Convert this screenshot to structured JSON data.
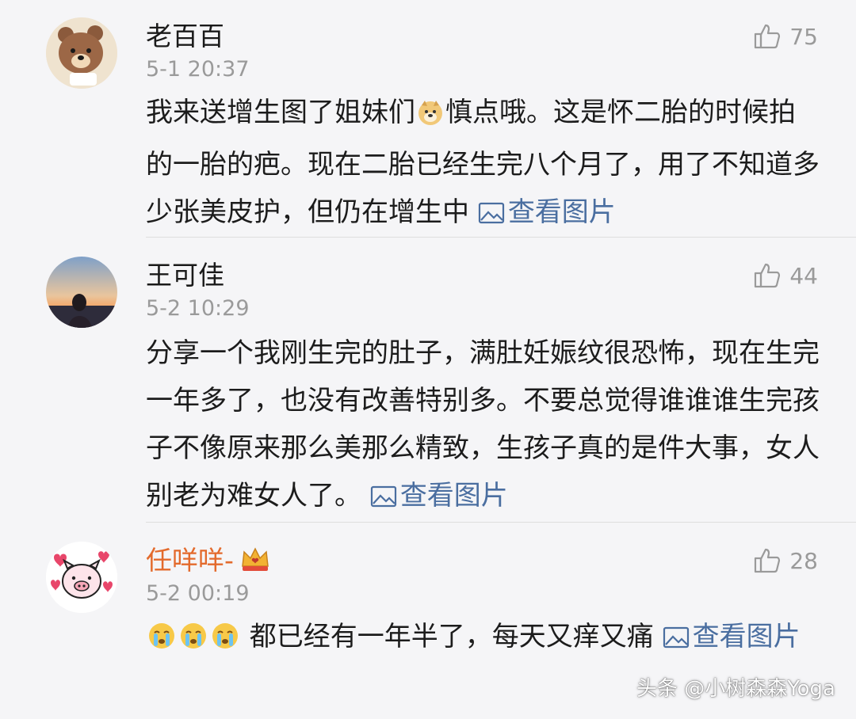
{
  "comments": [
    {
      "username": "老百百",
      "time": "5-1 20:37",
      "likes": "75",
      "text_parts": [
        "我来送增生图了姐妹们",
        "慎点哦。这是怀二胎的时候拍的一胎的疤。现在二胎已经生完八个月了，用了不知道多少张美皮护，但仍在增生中 "
      ],
      "view_pic": "查看图片",
      "avatar_icon": "bear-avatar",
      "inline_emoji": "doge-emoji"
    },
    {
      "username": "王可佳",
      "time": "5-2 10:29",
      "likes": "44",
      "text": "分享一个我刚生完的肚子，满肚妊娠纹很恐怖，现在生完一年多了，也没有改善特别多。不要总觉得谁谁谁生完孩子不像原来那么美那么精致，生孩子真的是件大事，女人别老为难女人了。 ",
      "view_pic": "查看图片",
      "avatar_icon": "sunset-photo-avatar"
    },
    {
      "username": "任咩咩-",
      "time": "5-2 00:19",
      "likes": "28",
      "text": " 都已经有一年半了，每天又痒又痛 ",
      "view_pic": "查看图片",
      "avatar_icon": "pig-avatar",
      "name_color": "#e36a2c",
      "badge_icon": "crown-icon",
      "inline_emoji": "crying-emoji"
    }
  ],
  "watermark": "头条 @小树森森Yoga",
  "colors": {
    "background": "#f5f5f7",
    "link": "#4a6ea0",
    "meta": "#9a9a9a",
    "vip_name": "#e36a2c"
  }
}
